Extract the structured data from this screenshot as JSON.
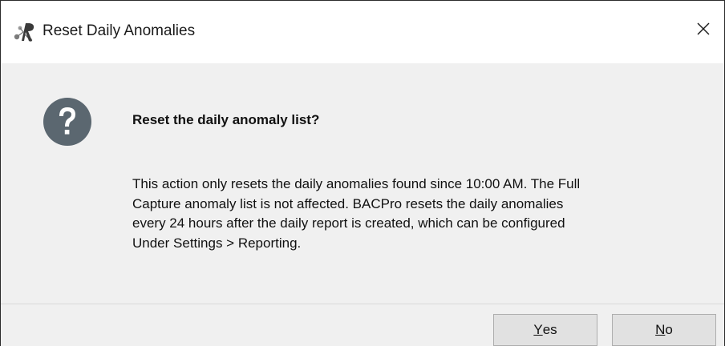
{
  "window": {
    "title": "Reset Daily Anomalies",
    "app_icon": "bacpro-app-icon",
    "close_icon": "close-icon"
  },
  "dialog": {
    "icon": "question-icon",
    "icon_color": "#5b6770",
    "heading": "Reset the daily anomaly list?",
    "message_lines": [
      "This action only resets the daily anomalies found since 10:00 AM. The Full",
      "Capture anomaly list is not affected. BACPro resets the daily anomalies",
      "every 24 hours after the daily report is created, which can be configured",
      "Under Settings > Reporting."
    ]
  },
  "buttons": {
    "yes": {
      "mnemonic": "Y",
      "rest": "es"
    },
    "no": {
      "mnemonic": "N",
      "rest": "o"
    }
  },
  "colors": {
    "content_bg": "#f0f0f0",
    "button_bg": "#e1e1e1",
    "button_border": "#adadad"
  }
}
